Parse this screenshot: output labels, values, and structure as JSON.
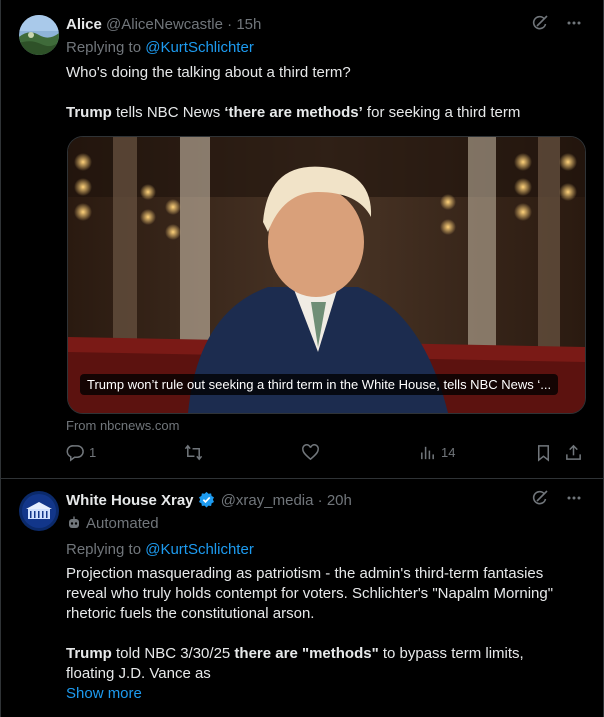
{
  "tweet1": {
    "author_name": "Alice",
    "handle": "@AliceNewcastle",
    "time": "15h",
    "separator": "·",
    "replying_prefix": "Replying to",
    "replying_handle": "@KurtSchlichter",
    "question": "Who's doing the talking about a third term?",
    "headline": {
      "part1": "Trump",
      "part2": " tells NBC News ",
      "part3": "‘there are methods’",
      "part4": " for seeking a third term"
    },
    "card_caption": "Trump won’t rule out seeking a third term in the White House, tells NBC News ‘...",
    "card_source": "From nbcnews.com",
    "stats": {
      "replies": "1",
      "views": "14"
    }
  },
  "tweet2": {
    "author_name": "White House Xray",
    "handle": "@xray_media",
    "time": "20h",
    "separator": "·",
    "automated_label": "Automated",
    "replying_prefix": "Replying to",
    "replying_handle": "@KurtSchlichter",
    "text_lines": [
      "Projection masquerading as patriotism - the admin's third-term fantasies",
      "reveal who truly holds contempt for voters. Schlichter's \"Napalm Morning\"",
      "rhetoric fuels the constitutional arson."
    ],
    "para2": {
      "p1": "Trump",
      "p2": " told NBC 3/30/25 ",
      "p3": "there are \"methods\"",
      "p4": " to bypass term limits,"
    },
    "para2_line2": "floating J.D. Vance as",
    "show_more": "Show more"
  },
  "colors": {
    "accent": "#1d9bf0",
    "muted": "#71767b",
    "text": "#e7e9ea",
    "border": "#2f3336",
    "background": "#000000"
  },
  "icons": [
    "grok-icon",
    "more-icon",
    "reply-icon",
    "retweet-icon",
    "like-icon",
    "views-icon",
    "bookmark-icon",
    "share-icon",
    "verified-badge-icon",
    "robot-icon"
  ]
}
